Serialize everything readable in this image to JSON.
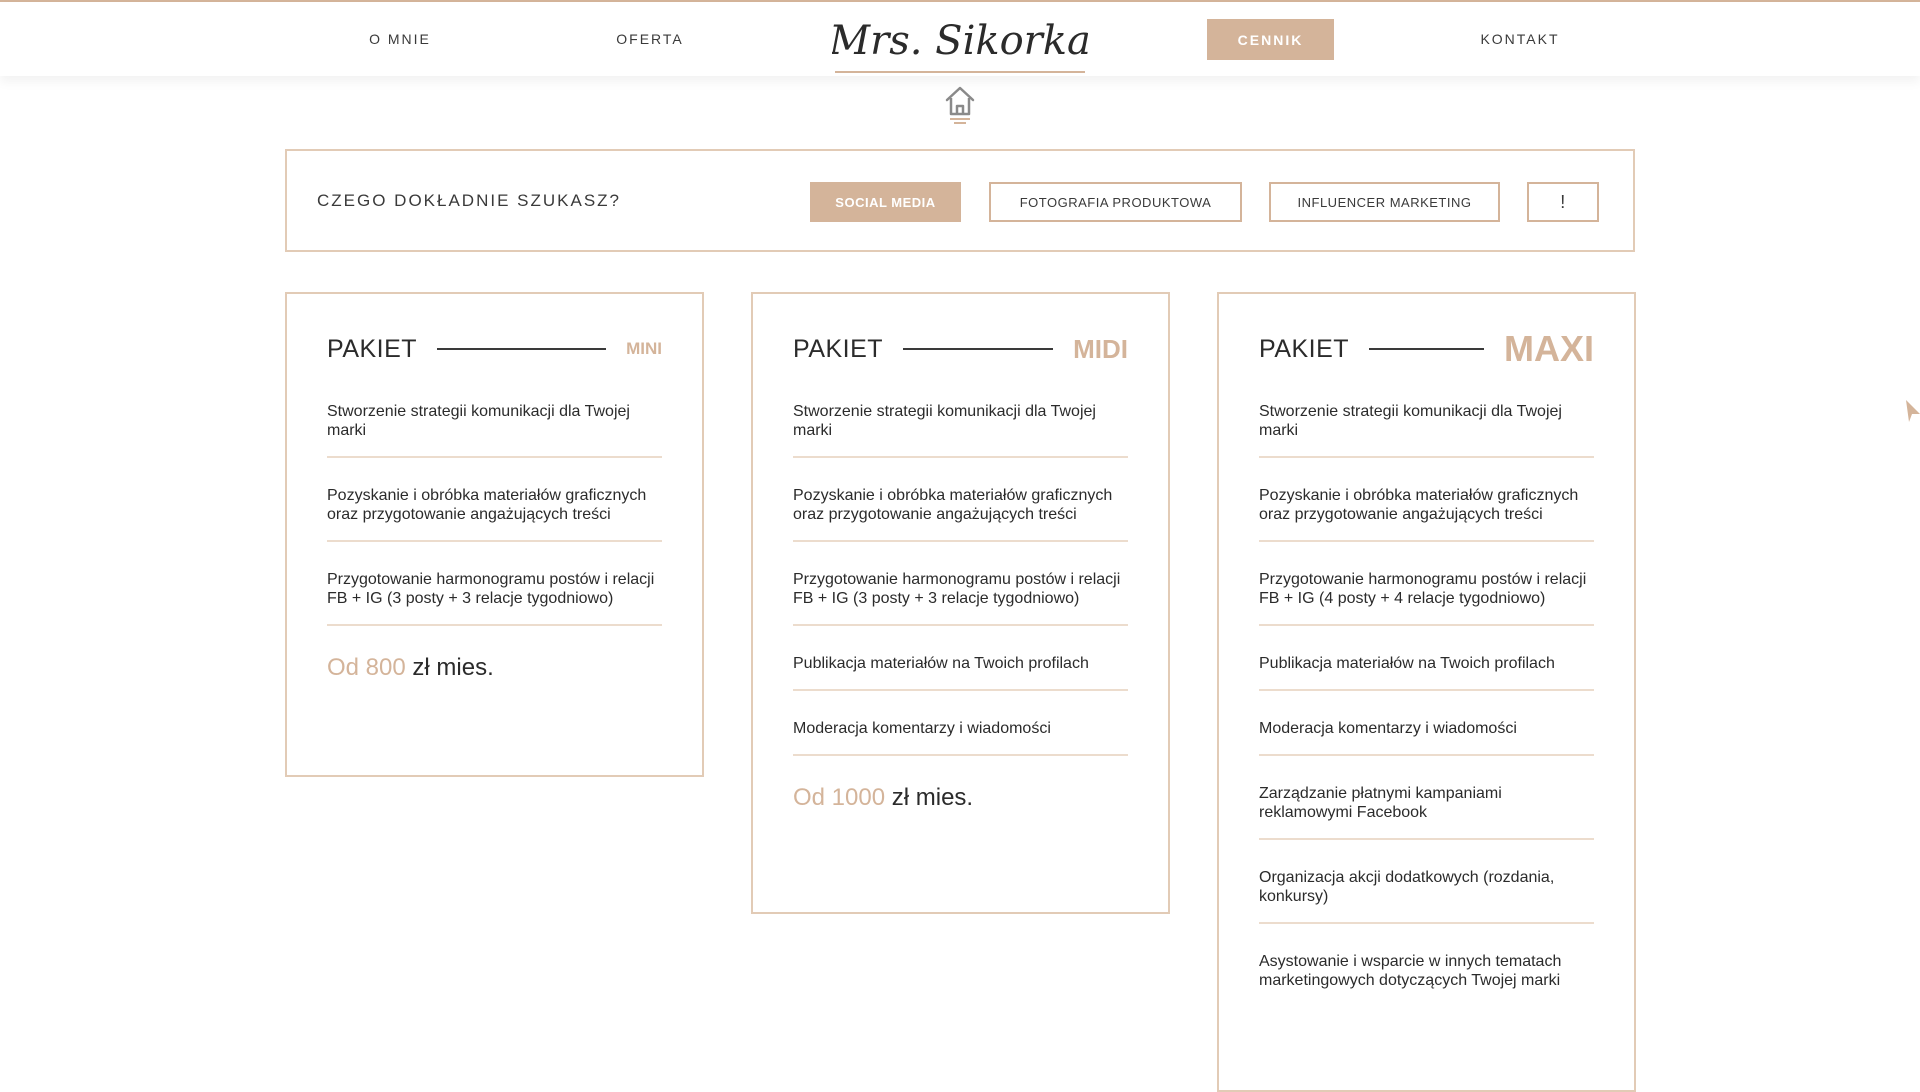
{
  "colors": {
    "accent": "#d4b49a",
    "text": "#2b2b2b",
    "border": "#e2cbb6"
  },
  "nav": {
    "o_mnie": "O MNIE",
    "oferta": "OFERTA",
    "logo_text": "Mrs. Sikorka",
    "cennik": "CENNIK",
    "kontakt": "KONTAKT"
  },
  "icons": {
    "home": "home-icon"
  },
  "filter": {
    "label": "CZEGO DOKŁADNIE SZUKASZ?",
    "options": [
      "SOCIAL MEDIA",
      "FOTOGRAFIA PRODUKTOWA",
      "INFLUENCER MARKETING",
      "!"
    ],
    "selected": "SOCIAL MEDIA"
  },
  "packages": [
    {
      "label": "PAKIET",
      "size": "MINI",
      "features": [
        "Stworzenie strategii komunikacji dla Twojej marki",
        "Pozyskanie i obróbka materiałów graficznych oraz przygotowanie angażujących treści",
        "Przygotowanie harmonogramu postów i relacji FB + IG (3 posty + 3 relacje tygodniowo)"
      ],
      "price_prefix": "Od 800",
      "price_suffix": " zł mies."
    },
    {
      "label": "PAKIET",
      "size": "MIDI",
      "features": [
        "Stworzenie strategii komunikacji dla Twojej marki",
        "Pozyskanie i obróbka materiałów graficznych oraz przygotowanie angażujących treści",
        "Przygotowanie harmonogramu postów i relacji FB + IG (3 posty + 3 relacje tygodniowo)",
        "Publikacja materiałów na Twoich profilach",
        "Moderacja komentarzy i wiadomości"
      ],
      "price_prefix": "Od 1000",
      "price_suffix": " zł mies."
    },
    {
      "label": "PAKIET",
      "size": "MAXI",
      "features": [
        "Stworzenie strategii komunikacji dla Twojej marki",
        "Pozyskanie i obróbka materiałów graficznych oraz przygotowanie angażujących treści",
        "Przygotowanie harmonogramu postów i relacji FB + IG (4 posty + 4 relacje tygodniowo)",
        "Publikacja materiałów na Twoich profilach",
        "Moderacja komentarzy i wiadomości",
        "Zarządzanie płatnymi kampaniami reklamowymi Facebook",
        "Organizacja akcji dodatkowych (rozdania, konkursy)",
        "Asystowanie i wsparcie w innych tematach marketingowych dotyczących Twojej marki"
      ]
    }
  ]
}
